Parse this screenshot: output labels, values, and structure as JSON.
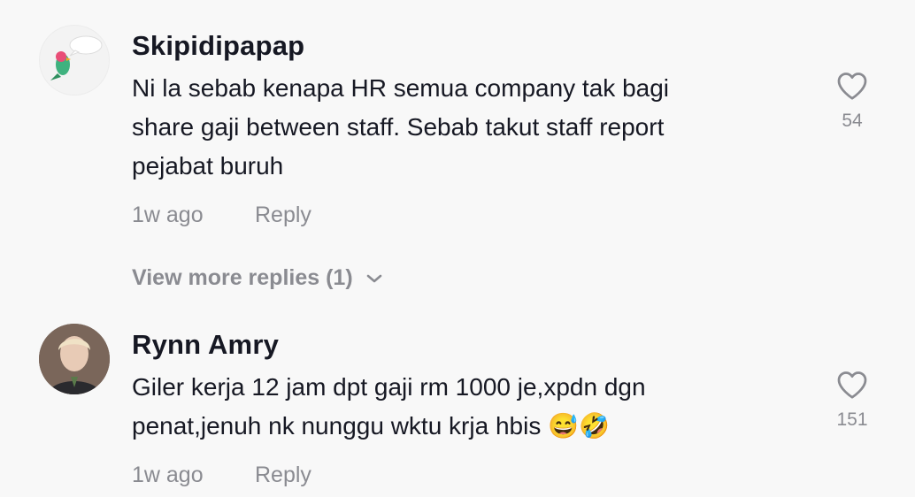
{
  "comments": [
    {
      "username": "Skipidipapap",
      "lines": [
        "Ni la sebab kenapa HR semua company tak bagi",
        "share gaji between staff. Sebab takut staff report",
        "pejabat buruh"
      ],
      "time": "1w ago",
      "reply_label": "Reply",
      "likes": "54",
      "avatar_icon": "parrot-sticker-icon",
      "view_more": "View more replies (1)"
    },
    {
      "username": "Rynn Amry",
      "lines": [
        "Giler kerja 12 jam dpt gaji rm 1000 je,xpdn dgn",
        "penat,jenuh nk nunggu wktu krja hbis 😅🤣"
      ],
      "time": "1w ago",
      "reply_label": "Reply",
      "likes": "151",
      "avatar_icon": "profile-photo"
    }
  ],
  "colors": {
    "background": "#f8f8f8",
    "primary_text": "#161823",
    "secondary_text": "#8a8b91"
  }
}
